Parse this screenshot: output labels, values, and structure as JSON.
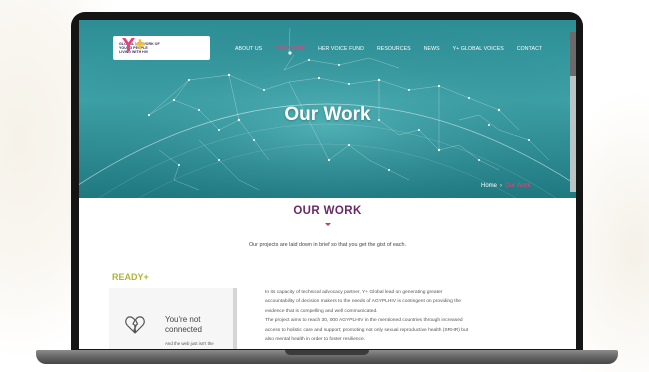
{
  "site": {
    "logo_text": [
      "GLOBAL NETWORK OF",
      "YOUNG PEOPLE",
      "LIVING WITH HIV"
    ],
    "nav": [
      {
        "label": "ABOUT US",
        "active": false
      },
      {
        "label": "OUR WORK",
        "active": true
      },
      {
        "label": "HER VOICE FUND",
        "active": false
      },
      {
        "label": "RESOURCES",
        "active": false
      },
      {
        "label": "NEWS",
        "active": false
      },
      {
        "label": "Y+ GLOBAL VOICES",
        "active": false
      },
      {
        "label": "CONTACT",
        "active": false
      }
    ],
    "hero_title": "Our Work",
    "breadcrumb": {
      "home": "Home",
      "separator": "›",
      "current": "Our Work"
    }
  },
  "content": {
    "section_title": "OUR WORK",
    "intro": "Our projects are laid down in brief so that you get the gist of each.",
    "program_heading": "READY+",
    "offline": {
      "title_line1": "You're not",
      "title_line2": "connected",
      "subtitle": "And the web just isn't the"
    },
    "paragraph_lines": [
      "In its capacity of technical advocacy partner, Y+ Global lead on generating greater",
      "accountability of decision makers to the needs of AGYPLHIV is contingent on providing the",
      "evidence that is compelling and well communicated.",
      "The project aims to reach 30, 000 AGYPLHIV in the mentioned countries through increased",
      "access to holistic care and support; promoting not only sexual reproductive health (SRHR) but",
      "also mental health in order to foster resilience."
    ]
  },
  "colors": {
    "brand_purple": "#6b2a66",
    "accent_pink": "#e0447a",
    "ready_green": "#b0b43a",
    "hero_teal": "#3ea3a8"
  },
  "icons": [
    "y-plus-logo-icon",
    "broken-heart-icon",
    "title-down-arrow-icon"
  ]
}
